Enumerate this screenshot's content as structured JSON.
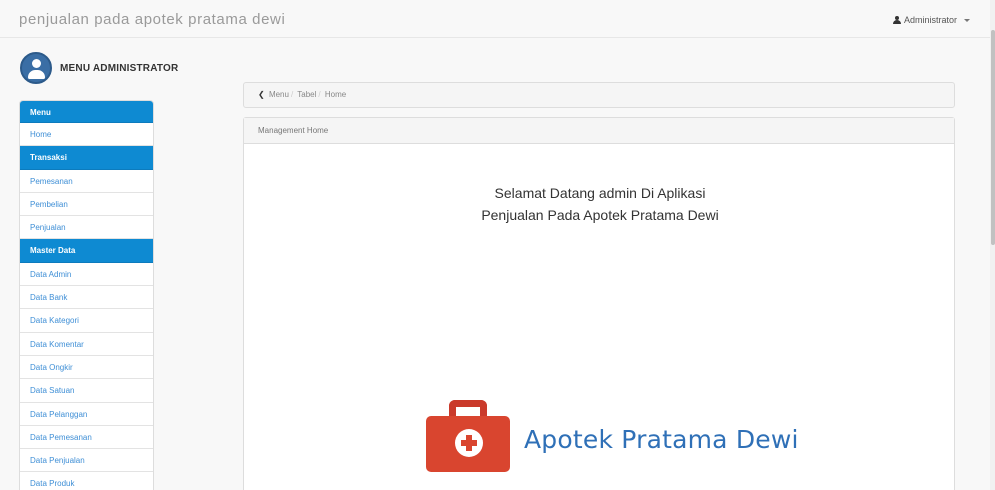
{
  "navbar": {
    "brand": "penjualan pada apotek pratama dewi",
    "user_label": "Administrator"
  },
  "sidebar": {
    "title": "MENU ADMINISTRATOR",
    "rows": [
      {
        "label": "Menu",
        "type": "head"
      },
      {
        "label": "Home",
        "type": "item"
      },
      {
        "label": "Transaksi",
        "type": "head"
      },
      {
        "label": "Pemesanan",
        "type": "item"
      },
      {
        "label": "Pembelian",
        "type": "item"
      },
      {
        "label": "Penjualan",
        "type": "item"
      },
      {
        "label": "Master Data",
        "type": "head"
      },
      {
        "label": "Data Admin",
        "type": "item"
      },
      {
        "label": "Data Bank",
        "type": "item"
      },
      {
        "label": "Data Kategori",
        "type": "item"
      },
      {
        "label": "Data Komentar",
        "type": "item"
      },
      {
        "label": "Data Ongkir",
        "type": "item"
      },
      {
        "label": "Data Satuan",
        "type": "item"
      },
      {
        "label": "Data Pelanggan",
        "type": "item"
      },
      {
        "label": "Data Pemesanan",
        "type": "item"
      },
      {
        "label": "Data Penjualan",
        "type": "item"
      },
      {
        "label": "Data Produk",
        "type": "item"
      }
    ]
  },
  "breadcrumb": {
    "items": [
      "Menu",
      "Tabel",
      "Home"
    ],
    "back_icon": "chevron-left-icon"
  },
  "panel": {
    "heading": "Management Home",
    "welcome_line1": "Selamat Datang admin Di Aplikasi",
    "welcome_line2": "Penjualan Pada Apotek Pratama Dewi",
    "logo_text": "Apotek Pratama Dewi"
  },
  "colors": {
    "menu_header": "#0e8ad2",
    "link": "#3f8fd6",
    "logo_red": "#d9452f",
    "logo_blue": "#2f70b7"
  }
}
